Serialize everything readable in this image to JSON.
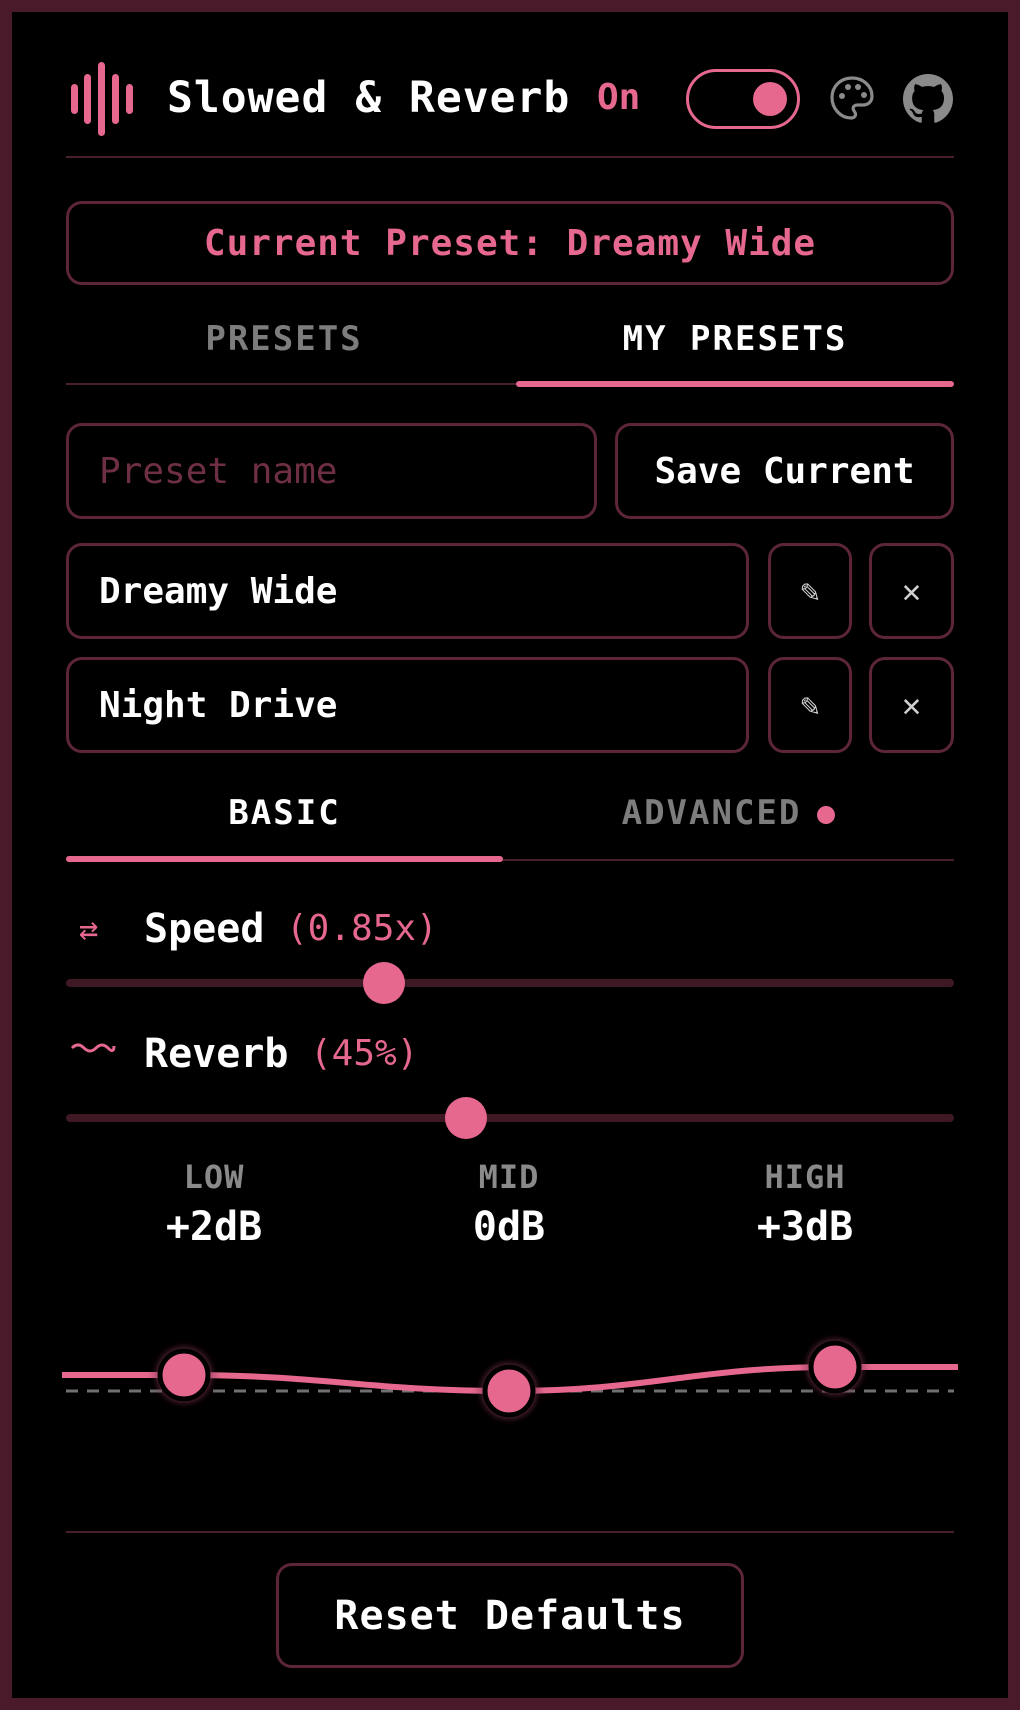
{
  "header": {
    "app_title": "Slowed & Reverb",
    "state_label": "On",
    "enabled": true,
    "logo_icon": "sound-wave-icon",
    "theme_icon": "palette-icon",
    "repo_icon": "github-icon"
  },
  "current_preset": {
    "text": "Current Preset: Dreamy Wide"
  },
  "preset_tabs": [
    {
      "label": "PRESETS",
      "active": false
    },
    {
      "label": "MY PRESETS",
      "active": true
    }
  ],
  "my_presets": {
    "input_placeholder": "Preset name",
    "input_value": "",
    "save_label": "Save Current",
    "items": [
      {
        "name": "Dreamy Wide",
        "edit_icon": "pencil-icon",
        "delete_icon": "close-icon"
      },
      {
        "name": "Night Drive",
        "edit_icon": "pencil-icon",
        "delete_icon": "close-icon"
      }
    ]
  },
  "mode_tabs": [
    {
      "label": "BASIC",
      "active": true
    },
    {
      "label": "ADVANCED",
      "active": false,
      "has_indicator": true
    }
  ],
  "controls": {
    "speed": {
      "label": "Speed",
      "value_text": "(0.85x)",
      "icon": "swap-arrows-icon",
      "fraction": 0.358
    },
    "reverb": {
      "label": "Reverb",
      "value_text": "(45%)",
      "icon": "wave-icon",
      "fraction": 0.45
    }
  },
  "eq": {
    "bands": [
      {
        "label": "LOW",
        "value": "+2dB",
        "gain_db": 2
      },
      {
        "label": "MID",
        "value": "0dB",
        "gain_db": 0
      },
      {
        "label": "HIGH",
        "value": "+3dB",
        "gain_db": 3
      }
    ]
  },
  "footer": {
    "reset_label": "Reset Defaults"
  },
  "colors": {
    "accent": "#e6688f",
    "border": "#5c2636",
    "background": "#000000"
  }
}
